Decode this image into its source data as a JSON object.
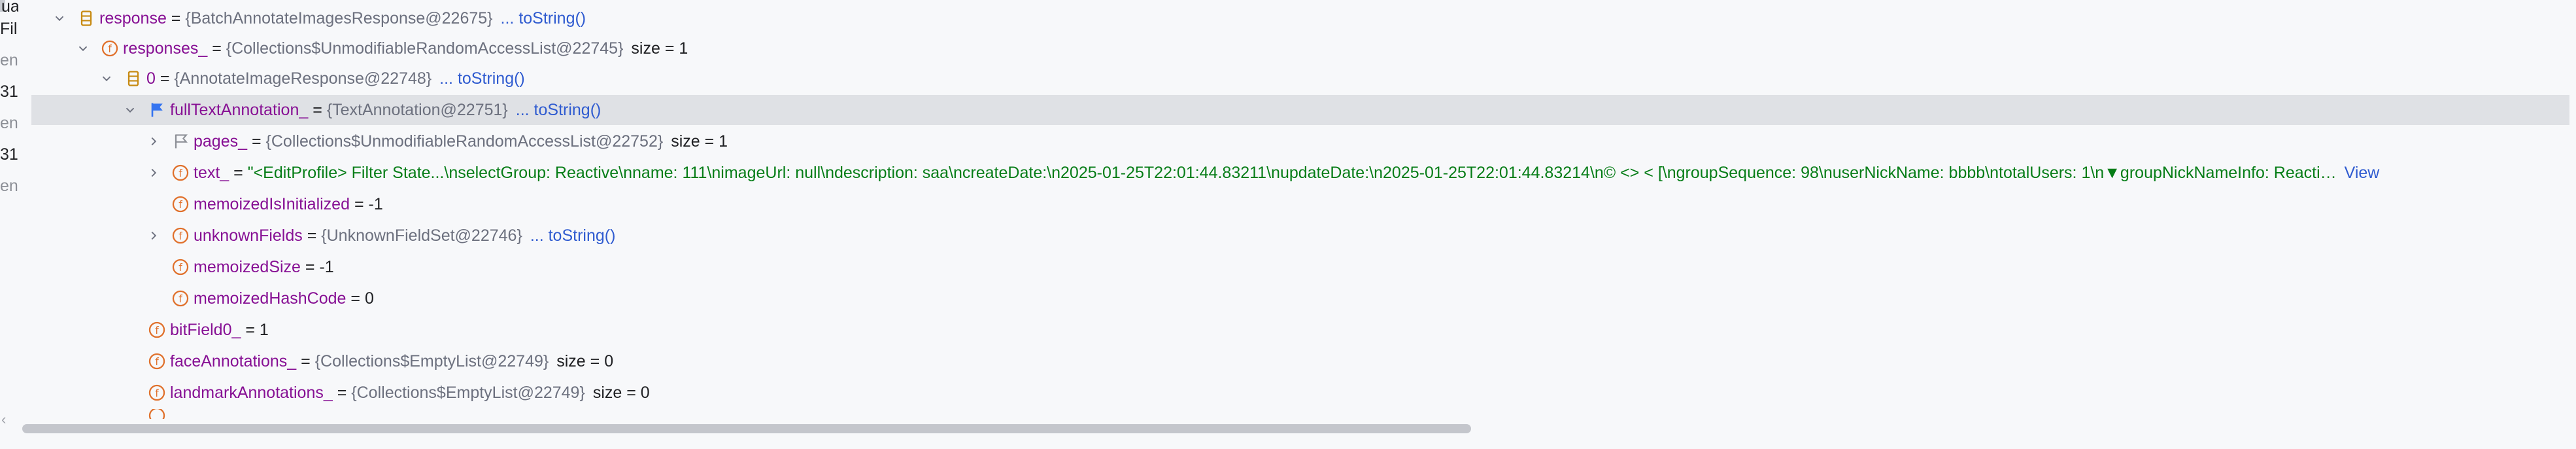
{
  "left_strip": {
    "fragments": [
      "ua",
      "Fil",
      "en",
      "31",
      "en",
      "31",
      "en"
    ]
  },
  "tree": {
    "rows": [
      {
        "name": "response",
        "ref": "{BatchAnnotateImagesResponse@22675}",
        "link": "... toString()",
        "extra": ""
      },
      {
        "name": "responses_",
        "ref": "{Collections$UnmodifiableRandomAccessList@22745}",
        "link": "",
        "extra": "size = 1"
      },
      {
        "name": "0",
        "ref": "{AnnotateImageResponse@22748}",
        "link": "... toString()",
        "extra": ""
      },
      {
        "name": "fullTextAnnotation_",
        "ref": "{TextAnnotation@22751}",
        "link": "... toString()",
        "extra": ""
      },
      {
        "name": "pages_",
        "ref": "{Collections$UnmodifiableRandomAccessList@22752}",
        "link": "",
        "extra": "size = 1"
      },
      {
        "name": "text_",
        "value": "\"<EditProfile> Filter State...\\nselectGroup: Reactive\\nname: 111\\nimageUrl: null\\ndescription: saa\\ncreateDate:\\n2025-01-25T22:01:44.83211\\nupdateDate:\\n2025-01-25T22:01:44.83214\\n© <> < [\\ngroupSequence: 98\\nuserNickName: bbbb\\ntotalUsers: 1\\n▼groupNickNameInfo: Reacti…",
        "link": "View"
      },
      {
        "name": "memoizedIsInitialized",
        "value": "-1"
      },
      {
        "name": "unknownFields",
        "ref": "{UnknownFieldSet@22746}",
        "link": "... toString()",
        "extra": ""
      },
      {
        "name": "memoizedSize",
        "value": "-1"
      },
      {
        "name": "memoizedHashCode",
        "value": "0"
      },
      {
        "name": "bitField0_",
        "value": "1"
      },
      {
        "name": "faceAnnotations_",
        "ref": "{Collections$EmptyList@22749}",
        "link": "",
        "extra": "size = 0"
      },
      {
        "name": "landmarkAnnotations_",
        "ref": "{Collections$EmptyList@22749}",
        "link": "",
        "extra": "size = 0"
      }
    ]
  },
  "colors": {
    "field_icon": "#e0702b",
    "object_icon": "#c78a12",
    "selected_row_bg": "#dfe1e5",
    "string_value": "#067d17",
    "link": "#2f5bd0",
    "field_name": "#871094"
  }
}
